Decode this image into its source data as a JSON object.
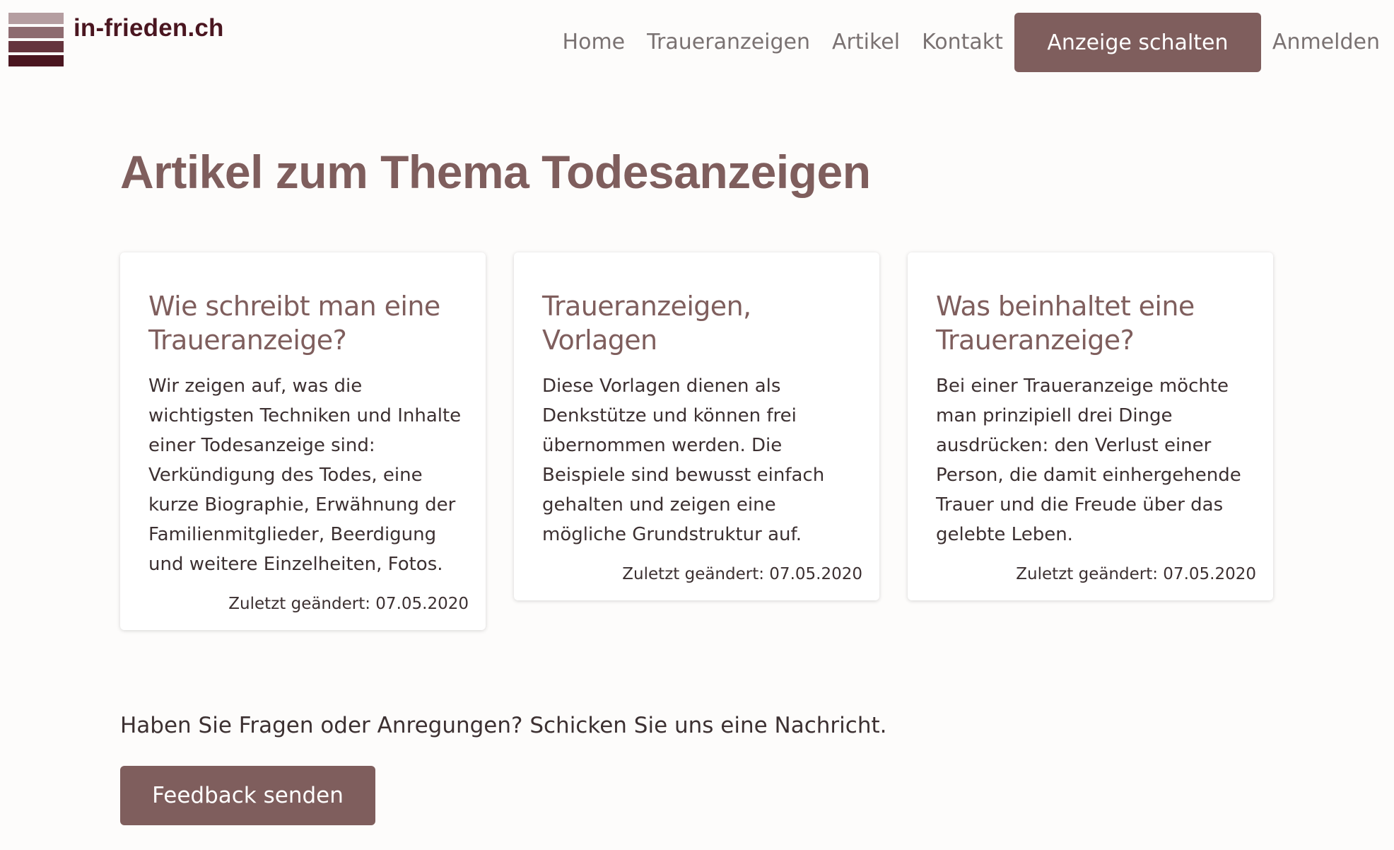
{
  "brand": {
    "name": "in-frieden.ch",
    "colors": {
      "primary": "#7f5e5d",
      "dark": "#4a1620",
      "text": "#3c3031",
      "nav": "#7a7272",
      "background": "#fdfcfb"
    }
  },
  "nav": {
    "home": "Home",
    "traueranzeigen": "Traueranzeigen",
    "artikel": "Artikel",
    "kontakt": "Kontakt",
    "cta": "Anzeige schalten",
    "login": "Anmelden"
  },
  "main": {
    "title": "Artikel zum Thema Todesanzeigen",
    "cards": [
      {
        "title": "Wie schreibt man eine Traueranzeige?",
        "text": "Wir zeigen auf, was die wichtigsten Techniken und Inhalte einer Todesanzeige sind: Verkündigung des Todes, eine kurze Biographie, Erwähnung der Familienmitglieder, Beerdigung und weitere Einzelheiten, Fotos.",
        "date": "Zuletzt geändert: 07.05.2020"
      },
      {
        "title": "Traueranzeigen, Vorlagen",
        "text": "Diese Vorlagen dienen als Denkstütze und können frei übernommen werden. Die Beispiele sind bewusst einfach gehalten und zeigen eine mögliche Grundstruktur auf.",
        "date": "Zuletzt geändert: 07.05.2020"
      },
      {
        "title": "Was beinhaltet eine Traueranzeige?",
        "text": "Bei einer Traueranzeige möchte man prinzipiell drei Dinge ausdrücken: den Verlust einer Person, die damit einhergehende Trauer und die Freude über das gelebte Leben.",
        "date": "Zuletzt geändert: 07.05.2020"
      }
    ]
  },
  "feedback": {
    "prompt": "Haben Sie Fragen oder Anregungen? Schicken Sie uns eine Nachricht.",
    "button": "Feedback senden"
  }
}
